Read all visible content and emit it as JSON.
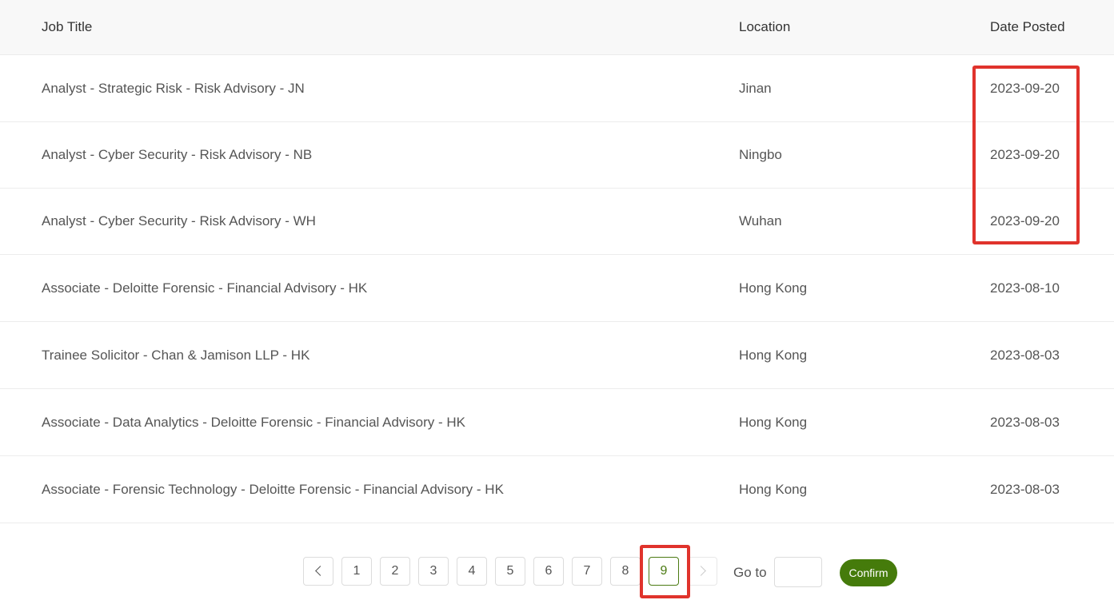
{
  "table": {
    "headers": {
      "title": "Job Title",
      "location": "Location",
      "date": "Date Posted"
    },
    "rows": [
      {
        "title": "Analyst - Strategic Risk - Risk Advisory - JN",
        "location": "Jinan",
        "date": "2023-09-20"
      },
      {
        "title": "Analyst - Cyber Security - Risk Advisory - NB",
        "location": "Ningbo",
        "date": "2023-09-20"
      },
      {
        "title": "Analyst - Cyber Security - Risk Advisory - WH",
        "location": "Wuhan",
        "date": "2023-09-20"
      },
      {
        "title": "Associate - Deloitte Forensic - Financial Advisory - HK",
        "location": "Hong Kong",
        "date": "2023-08-10"
      },
      {
        "title": "Trainee Solicitor - Chan & Jamison LLP - HK",
        "location": "Hong Kong",
        "date": "2023-08-03"
      },
      {
        "title": "Associate - Data Analytics - Deloitte Forensic - Financial Advisory - HK",
        "location": "Hong Kong",
        "date": "2023-08-03"
      },
      {
        "title": "Associate - Forensic Technology - Deloitte Forensic - Financial Advisory - HK",
        "location": "Hong Kong",
        "date": "2023-08-03"
      }
    ]
  },
  "pagination": {
    "pages": [
      "1",
      "2",
      "3",
      "4",
      "5",
      "6",
      "7",
      "8",
      "9"
    ],
    "current": "9",
    "goto_label": "Go to",
    "goto_value": "",
    "confirm_label": "Confirm"
  },
  "colors": {
    "accent": "#457b0b",
    "highlight": "#e0332c"
  }
}
